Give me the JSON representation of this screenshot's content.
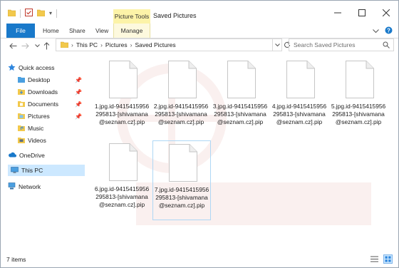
{
  "window": {
    "title": "Saved Pictures",
    "context_tab": "Picture Tools"
  },
  "ribbon": {
    "tabs": [
      "File",
      "Home",
      "Share",
      "View",
      "Manage"
    ]
  },
  "address": {
    "path": [
      "This PC",
      "Pictures",
      "Saved Pictures"
    ],
    "search_placeholder": "Search Saved Pictures"
  },
  "sidebar": {
    "items": [
      {
        "label": "Quick access",
        "icon": "star-icon"
      },
      {
        "label": "Desktop",
        "icon": "folder-icon",
        "pinned": true
      },
      {
        "label": "Downloads",
        "icon": "download-folder-icon",
        "pinned": true
      },
      {
        "label": "Documents",
        "icon": "documents-folder-icon",
        "pinned": true
      },
      {
        "label": "Pictures",
        "icon": "pictures-folder-icon",
        "pinned": true
      },
      {
        "label": "Music",
        "icon": "music-folder-icon"
      },
      {
        "label": "Videos",
        "icon": "videos-folder-icon"
      },
      {
        "label": "OneDrive",
        "icon": "cloud-icon"
      },
      {
        "label": "This PC",
        "icon": "computer-icon",
        "selected": true
      },
      {
        "label": "Network",
        "icon": "network-icon"
      }
    ]
  },
  "files": [
    {
      "name": "1.jpg.id-9415415956295813-[shivamana@seznam.cz].pip"
    },
    {
      "name": "2.jpg.id-9415415956295813-[shivamana@seznam.cz].pip"
    },
    {
      "name": "3.jpg.id-9415415956295813-[shivamana@seznam.cz].pip"
    },
    {
      "name": "4.jpg.id-9415415956295813-[shivamana@seznam.cz].pip"
    },
    {
      "name": "5.jpg.id-9415415956295813-[shivamana@seznam.cz].pip"
    },
    {
      "name": "6.jpg.id-9415415956295813-[shivamana@seznam.cz].pip"
    },
    {
      "name": "7.jpg.id-9415415956295813-[shivamana@seznam.cz].pip"
    }
  ],
  "status": {
    "item_count": "7 items"
  },
  "colors": {
    "accent": "#1979ca",
    "context_tab": "#fcf3a8",
    "selection": "#cce8ff",
    "folder": "#f2c94c"
  }
}
